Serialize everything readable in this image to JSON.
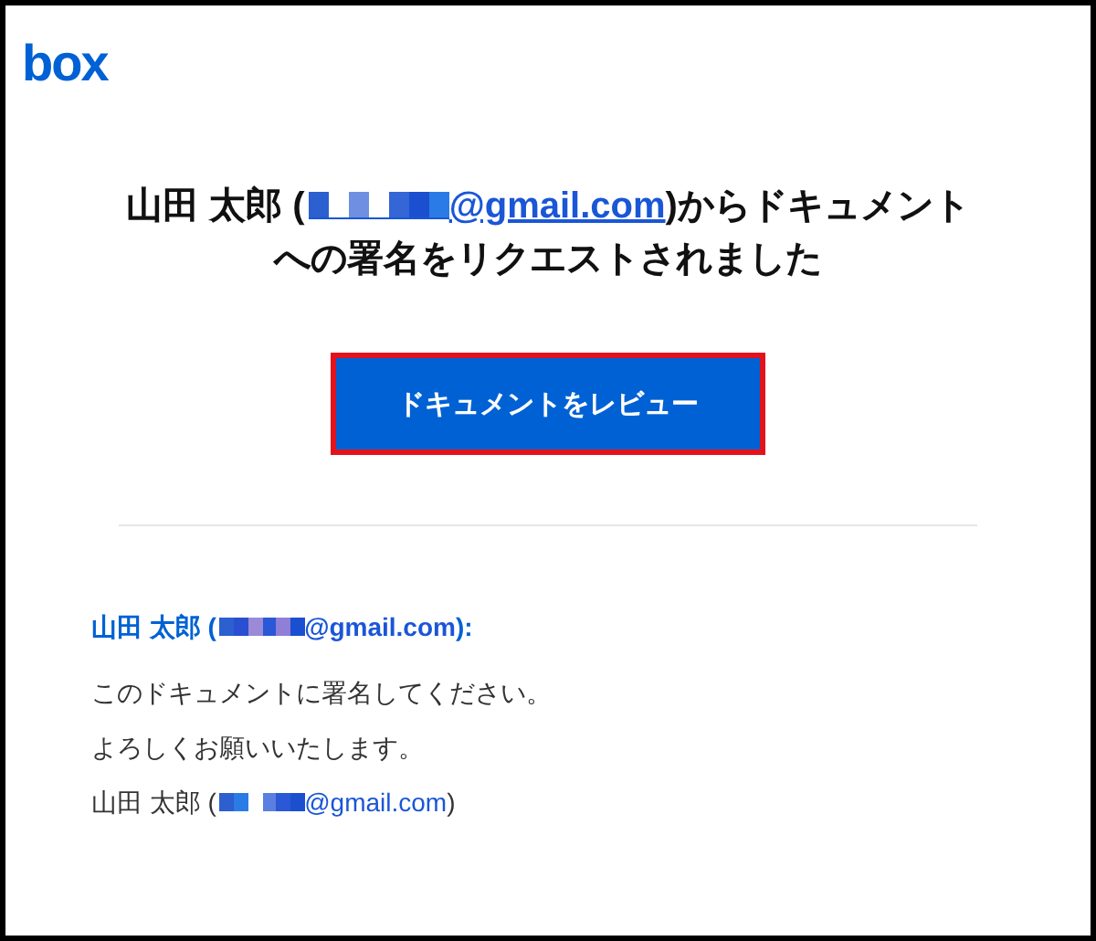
{
  "logo": "box",
  "heading": {
    "name": "山田 太郎 (",
    "email": "@gmail.com",
    "lines": [
      ")からドキュメント",
      "への署名をリクエストされました"
    ]
  },
  "review_button": {
    "label": "ドキュメントをレビュー",
    "highlighted": true
  },
  "message": {
    "greeting": {
      "name": "山田 太郎 (",
      "email": "@gmail.com",
      "end": "):"
    },
    "paragraphs": [
      "このドキュメントに署名してください。",
      "よろしくお願いいたします。"
    ],
    "signature": {
      "name": "山田 太郎 (",
      "email": "@gmail.com",
      "end": ")"
    }
  }
}
